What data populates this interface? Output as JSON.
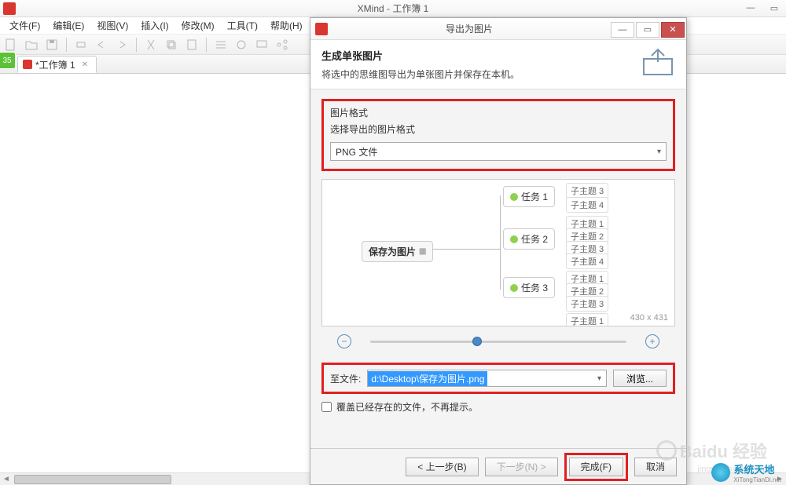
{
  "main": {
    "title": "XMind - 工作簿 1",
    "menus": [
      "文件(F)",
      "编辑(E)",
      "视图(V)",
      "插入(I)",
      "修改(M)",
      "工具(T)",
      "帮助(H)"
    ],
    "side_badge": "35",
    "tab_label": "*工作簿 1"
  },
  "dialog": {
    "title": "导出为图片",
    "header_title": "生成单张图片",
    "header_desc": "将选中的思维图导出为单张图片并保存在本机。",
    "format_section_title": "图片格式",
    "format_section_desc": "选择导出的图片格式",
    "format_value": "PNG 文件",
    "preview_dims": "430 x 431",
    "mindmap": {
      "root": "保存为图片",
      "tasks": [
        "任务 1",
        "任务 2",
        "任务 3"
      ],
      "leaf_prefix": "子主题"
    },
    "file_label": "至文件:",
    "file_value": "d:\\Desktop\\保存为图片.png",
    "browse_label": "浏览...",
    "overwrite_label": "覆盖已经存在的文件，不再提示。",
    "buttons": {
      "back": "< 上一步(B)",
      "next": "下一步(N) >",
      "finish": "完成(F)",
      "cancel": "取消"
    }
  },
  "watermark": {
    "baidu": "Baidu 经验",
    "baidu_sub": "jingyan.baidu.com",
    "xt_name": "系统天地",
    "xt_sub": "XiTongTianDi.net"
  }
}
